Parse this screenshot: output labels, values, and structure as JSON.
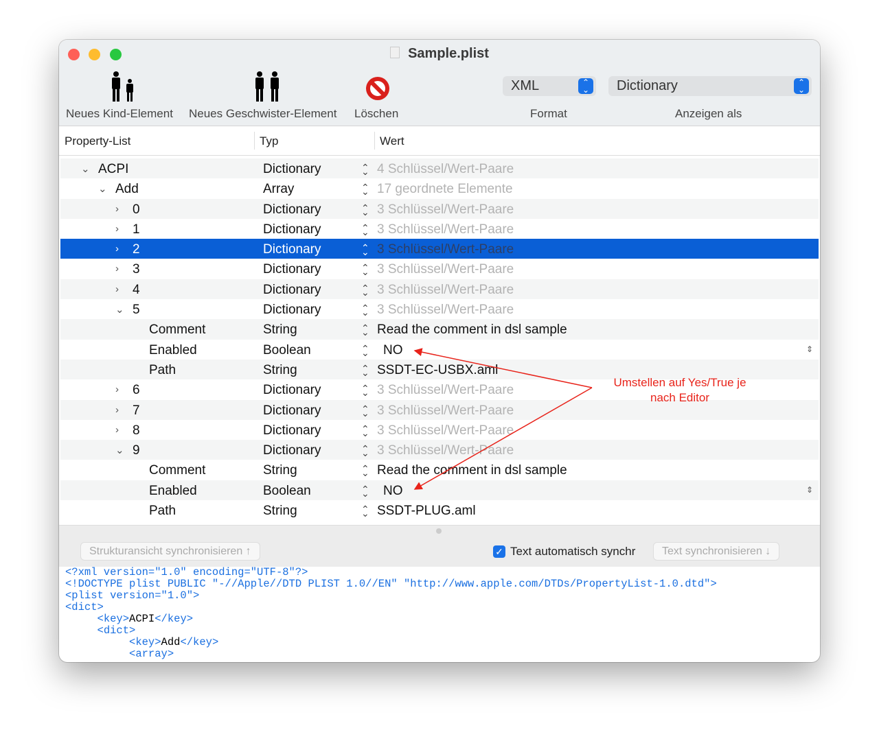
{
  "window": {
    "title": "Sample.plist"
  },
  "toolbar": {
    "new_child": "Neues Kind-Element",
    "new_sibling": "Neues Geschwister-Element",
    "delete": "Löschen",
    "format_value": "XML",
    "format_label": "Format",
    "view_value": "Dictionary",
    "view_label": "Anzeigen als"
  },
  "columns": {
    "key": "Property-List",
    "type": "Typ",
    "value": "Wert"
  },
  "rows": [
    {
      "key": "ACPI",
      "type": "Dictionary",
      "value": "4 Schlüssel/Wert-Paare",
      "level": 0,
      "disclosure": "open",
      "dim": true
    },
    {
      "key": "Add",
      "type": "Array",
      "value": "17 geordnete Elemente",
      "level": 1,
      "disclosure": "open",
      "dim": true
    },
    {
      "key": "0",
      "type": "Dictionary",
      "value": "3 Schlüssel/Wert-Paare",
      "level": 2,
      "disclosure": "closed",
      "dim": true
    },
    {
      "key": "1",
      "type": "Dictionary",
      "value": "3 Schlüssel/Wert-Paare",
      "level": 2,
      "disclosure": "closed",
      "dim": true
    },
    {
      "key": "2",
      "type": "Dictionary",
      "value": "3 Schlüssel/Wert-Paare",
      "level": 2,
      "disclosure": "closed",
      "dim": true,
      "selected": true
    },
    {
      "key": "3",
      "type": "Dictionary",
      "value": "3 Schlüssel/Wert-Paare",
      "level": 2,
      "disclosure": "closed",
      "dim": true
    },
    {
      "key": "4",
      "type": "Dictionary",
      "value": "3 Schlüssel/Wert-Paare",
      "level": 2,
      "disclosure": "closed",
      "dim": true
    },
    {
      "key": "5",
      "type": "Dictionary",
      "value": "3 Schlüssel/Wert-Paare",
      "level": 2,
      "disclosure": "open",
      "dim": true
    },
    {
      "key": "Comment",
      "type": "String",
      "value": "Read the comment in dsl sample",
      "level": 3
    },
    {
      "key": "Enabled",
      "type": "Boolean",
      "value": "NO",
      "level": 3,
      "popup": true
    },
    {
      "key": "Path",
      "type": "String",
      "value": "SSDT-EC-USBX.aml",
      "level": 3
    },
    {
      "key": "6",
      "type": "Dictionary",
      "value": "3 Schlüssel/Wert-Paare",
      "level": 2,
      "disclosure": "closed",
      "dim": true
    },
    {
      "key": "7",
      "type": "Dictionary",
      "value": "3 Schlüssel/Wert-Paare",
      "level": 2,
      "disclosure": "closed",
      "dim": true
    },
    {
      "key": "8",
      "type": "Dictionary",
      "value": "3 Schlüssel/Wert-Paare",
      "level": 2,
      "disclosure": "closed",
      "dim": true
    },
    {
      "key": "9",
      "type": "Dictionary",
      "value": "3 Schlüssel/Wert-Paare",
      "level": 2,
      "disclosure": "open",
      "dim": true
    },
    {
      "key": "Comment",
      "type": "String",
      "value": "Read the comment in dsl sample",
      "level": 3
    },
    {
      "key": "Enabled",
      "type": "Boolean",
      "value": "NO",
      "level": 3,
      "popup": true
    },
    {
      "key": "Path",
      "type": "String",
      "value": "SSDT-PLUG.aml",
      "level": 3
    }
  ],
  "annotation": {
    "line1": "Umstellen auf Yes/True je",
    "line2": "nach Editor",
    "color": "#e8231a"
  },
  "sync": {
    "structure_button": "Strukturansicht synchronisieren ↑",
    "auto_sync_label": "Text automatisch synchr",
    "auto_sync_checked": true,
    "text_button": "Text synchronisieren ↓"
  },
  "code": {
    "l1": "<?xml version=\"1.0\" encoding=\"UTF-8\"?>",
    "l2": "<!DOCTYPE plist PUBLIC \"-//Apple//DTD PLIST 1.0//EN\" \"http://www.apple.com/DTDs/PropertyList-1.0.dtd\">",
    "l3": "<plist version=\"1.0\">",
    "l4": "<dict>",
    "key_open": "<key>",
    "key_close": "</key>",
    "k1": "ACPI",
    "l6": "<dict>",
    "k2": "Add",
    "l8": "<array>"
  }
}
